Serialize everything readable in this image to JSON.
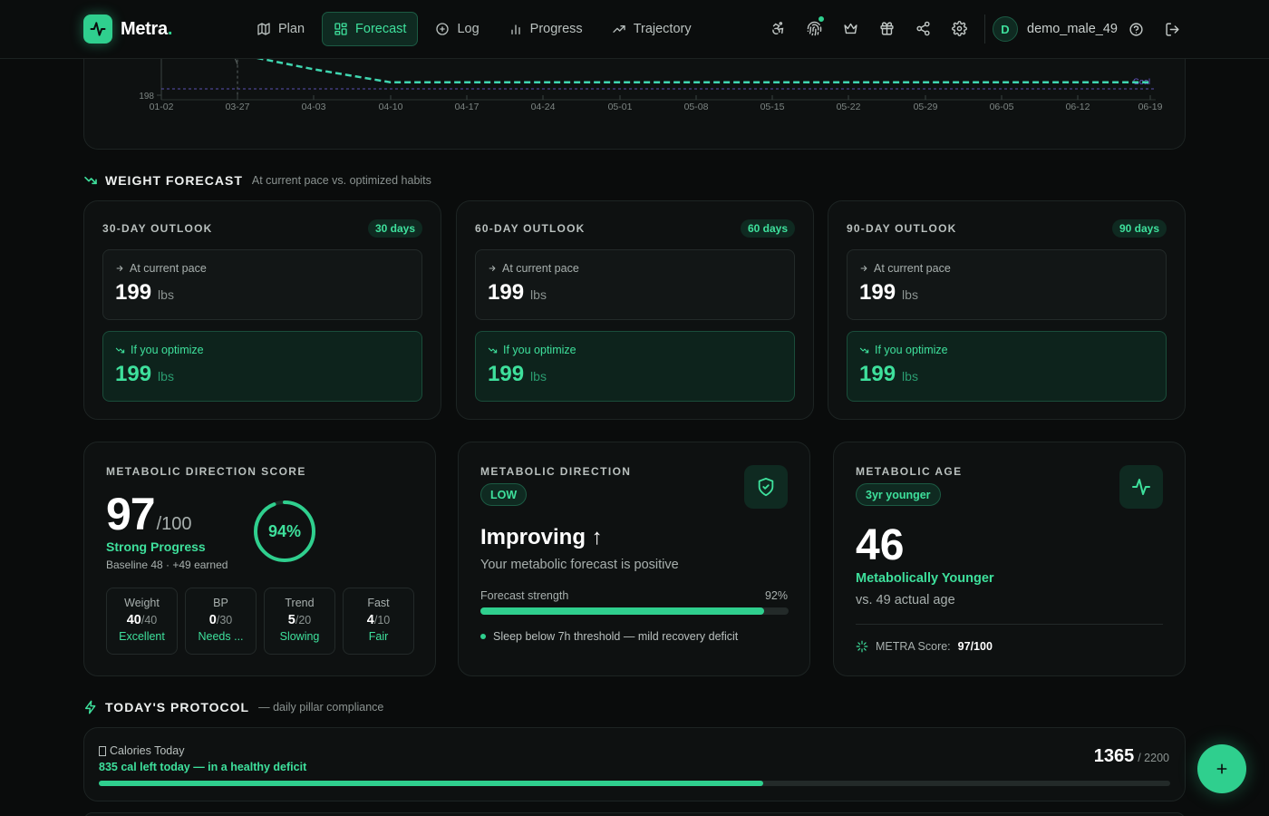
{
  "app": {
    "name": "Metra",
    "dot": "."
  },
  "nav": [
    {
      "label": "Plan",
      "icon": "map-icon"
    },
    {
      "label": "Forecast",
      "icon": "grid-icon",
      "active": true
    },
    {
      "label": "Log",
      "icon": "plus-circle-icon"
    },
    {
      "label": "Progress",
      "icon": "bar-chart-icon"
    },
    {
      "label": "Trajectory",
      "icon": "trending-up-icon"
    }
  ],
  "user": {
    "initial": "D",
    "name": "demo_male_49"
  },
  "chart_data": {
    "type": "line",
    "x": [
      "01-02",
      "03-27",
      "04-03",
      "04-10",
      "04-17",
      "04-24",
      "05-01",
      "05-08",
      "05-15",
      "05-22",
      "05-29",
      "06-05",
      "06-12",
      "06-19"
    ],
    "ytick": "198",
    "goal_label": "Goal",
    "series": [
      {
        "values": [
          null,
          199.6,
          198.9,
          198.3,
          198.3,
          198.3,
          198.3,
          198.3,
          198.3,
          198.3,
          198.3,
          198.3,
          198.3,
          198.3
        ]
      }
    ],
    "colors": {
      "line": "#3fd6b0",
      "goal": "#6d5fd6"
    }
  },
  "forecast": {
    "title": "WEIGHT FORECAST",
    "subtitle": "At current pace vs. optimized habits",
    "outlooks": [
      {
        "title": "30-DAY OUTLOOK",
        "badge": "30 days",
        "current_label": "At current pace",
        "current_value": "199",
        "optimize_label": "If you optimize",
        "optimize_value": "199",
        "unit": "lbs"
      },
      {
        "title": "60-DAY OUTLOOK",
        "badge": "60 days",
        "current_label": "At current pace",
        "current_value": "199",
        "optimize_label": "If you optimize",
        "optimize_value": "199",
        "unit": "lbs"
      },
      {
        "title": "90-DAY OUTLOOK",
        "badge": "90 days",
        "current_label": "At current pace",
        "current_value": "199",
        "optimize_label": "If you optimize",
        "optimize_value": "199",
        "unit": "lbs"
      }
    ]
  },
  "score": {
    "kicker": "METABOLIC DIRECTION SCORE",
    "value": "97",
    "max": "/100",
    "status": "Strong Progress",
    "sub": "Baseline 48 · +49 earned",
    "ring_pct": "94%",
    "ring_fraction": 0.94,
    "pillars": [
      {
        "name": "Weight",
        "value": "40",
        "max": "/40",
        "tag": "Excellent"
      },
      {
        "name": "BP",
        "value": "0",
        "max": "/30",
        "tag": "Needs ..."
      },
      {
        "name": "Trend",
        "value": "5",
        "max": "/20",
        "tag": "Slowing"
      },
      {
        "name": "Fast",
        "value": "4",
        "max": "/10",
        "tag": "Fair"
      }
    ]
  },
  "direction": {
    "kicker": "METABOLIC DIRECTION",
    "badge": "LOW",
    "title": "Improving ↑",
    "sub": "Your metabolic forecast is positive",
    "strength_label": "Forecast strength",
    "strength_pct": "92%",
    "strength_fraction": 0.92,
    "note": "Sleep below 7h threshold — mild recovery deficit"
  },
  "age": {
    "kicker": "METABOLIC AGE",
    "badge": "3yr younger",
    "value": "46",
    "status": "Metabolically Younger",
    "sub": "vs. 49 actual age",
    "metra_label": "METRA Score:",
    "metra_value": "97/100"
  },
  "protocol": {
    "title": "TODAY'S PROTOCOL",
    "subtitle": "— daily pillar compliance",
    "calories_label": "Calories Today",
    "calories_left": "835 cal left today — in a healthy deficit",
    "calories_value": "1365",
    "calories_target": "/ 2200",
    "calories_fraction": 0.62
  },
  "colors": {
    "accent": "#2fcf8e",
    "background": "#0a0c0c",
    "card": "#0e1111"
  }
}
